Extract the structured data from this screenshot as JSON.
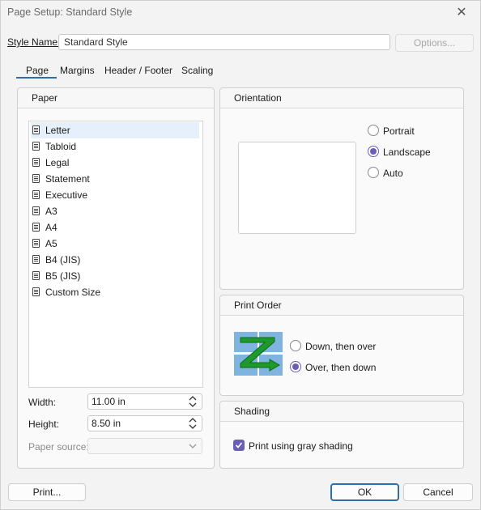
{
  "window": {
    "title": "Page Setup: Standard Style",
    "close_icon": "close-icon"
  },
  "style": {
    "label": "Style Name:",
    "value": "Standard Style",
    "options_button": "Options..."
  },
  "tabs": [
    {
      "label": "Page",
      "selected": true
    },
    {
      "label": "Margins",
      "selected": false
    },
    {
      "label": "Header / Footer",
      "selected": false
    },
    {
      "label": "Scaling",
      "selected": false
    }
  ],
  "paper": {
    "heading": "Paper",
    "items": [
      "Letter",
      "Tabloid",
      "Legal",
      "Statement",
      "Executive",
      "A3",
      "A4",
      "A5",
      "B4 (JIS)",
      "B5 (JIS)",
      "Custom Size"
    ],
    "selected": "Letter",
    "width_label": "Width:",
    "width_value": "11.00 in",
    "height_label": "Height:",
    "height_value": "8.50 in",
    "source_label": "Paper source:",
    "source_value": ""
  },
  "orientation": {
    "heading": "Orientation",
    "options": [
      {
        "label": "Portrait",
        "checked": false
      },
      {
        "label": "Landscape",
        "checked": true
      },
      {
        "label": "Auto",
        "checked": false
      }
    ]
  },
  "print_order": {
    "heading": "Print Order",
    "icon": "z-order-icon",
    "options": [
      {
        "label": "Down, then over",
        "checked": false
      },
      {
        "label": "Over, then down",
        "checked": true
      }
    ]
  },
  "shading": {
    "heading": "Shading",
    "checkbox_label": "Print using gray shading",
    "checked": true
  },
  "buttons": {
    "print": "Print...",
    "ok": "OK",
    "cancel": "Cancel"
  },
  "colors": {
    "accent": "#6b5fb5",
    "tab_underline": "#2f6ea8",
    "selection": "#e5f0fb"
  }
}
